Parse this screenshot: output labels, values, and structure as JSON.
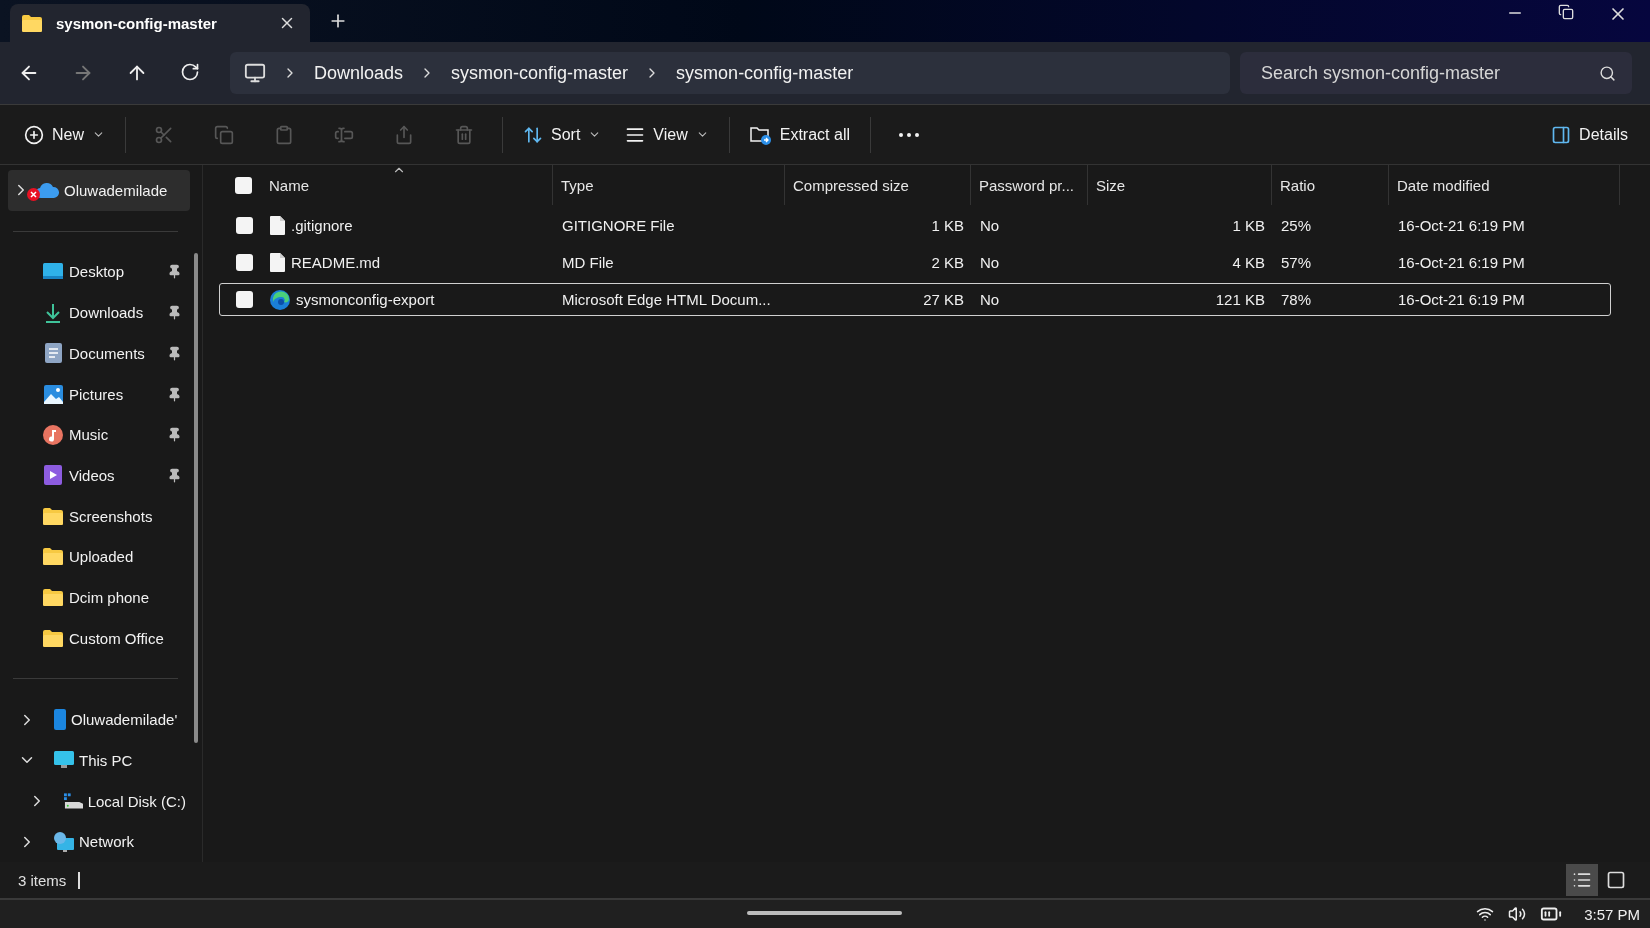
{
  "window": {
    "tabs": [
      {
        "title": "sysmon-config-master",
        "selected": true
      }
    ]
  },
  "navigation": {
    "breadcrumbs": [
      "Downloads",
      "sysmon-config-master",
      "sysmon-config-master"
    ],
    "search": {
      "placeholder": "Search sysmon-config-master"
    }
  },
  "toolbar": {
    "items": [
      {
        "kind": "new",
        "label": "New",
        "disabled": false
      },
      {
        "kind": "cut",
        "disabled": true
      },
      {
        "kind": "copy",
        "disabled": true
      },
      {
        "kind": "paste",
        "disabled": true
      },
      {
        "kind": "rename",
        "disabled": true
      },
      {
        "kind": "share",
        "disabled": true
      },
      {
        "kind": "delete",
        "disabled": true
      },
      {
        "kind": "sort",
        "label": "Sort",
        "disabled": false
      },
      {
        "kind": "view",
        "label": "View",
        "disabled": false
      },
      {
        "kind": "extract",
        "label": "Extract all",
        "disabled": false
      },
      {
        "kind": "more",
        "disabled": false
      }
    ],
    "details": "Details"
  },
  "sidebar": {
    "top": [
      {
        "label": "Oluwademilade",
        "kind": "cloud",
        "selected": true,
        "expanded": false
      }
    ],
    "quick_access": [
      {
        "label": "Desktop",
        "kind": "desktop",
        "pinned": true
      },
      {
        "label": "Downloads",
        "kind": "downloads",
        "pinned": true
      },
      {
        "label": "Documents",
        "kind": "documents",
        "pinned": true
      },
      {
        "label": "Pictures",
        "kind": "pictures",
        "pinned": true
      },
      {
        "label": "Music",
        "kind": "music",
        "pinned": true
      },
      {
        "label": "Videos",
        "kind": "videos",
        "pinned": true
      },
      {
        "label": "Screenshots",
        "kind": "folder",
        "pinned": false
      },
      {
        "label": "Uploaded",
        "kind": "folder",
        "pinned": false
      },
      {
        "label": "Dcim phone",
        "kind": "folder",
        "pinned": false
      },
      {
        "label": "Custom Office",
        "kind": "folder",
        "pinned": false
      }
    ],
    "tree": [
      {
        "label": "Oluwademilade'",
        "kind": "phone",
        "expanded": false
      },
      {
        "label": "This PC",
        "kind": "pc",
        "expanded": true,
        "children": [
          {
            "label": "Local Disk (C:)",
            "kind": "disk",
            "expanded": false
          }
        ]
      },
      {
        "label": "Network",
        "kind": "network",
        "expanded": false
      }
    ]
  },
  "table": {
    "select_all_checked": false,
    "columns": [
      {
        "label": "Name",
        "sorted": true
      },
      {
        "label": "Type",
        "sorted": false
      },
      {
        "label": "Compressed size",
        "sorted": false
      },
      {
        "label": "Password pr...",
        "sorted": false
      },
      {
        "label": "Size",
        "sorted": false
      },
      {
        "label": "Ratio",
        "sorted": false
      },
      {
        "label": "Date modified",
        "sorted": false
      }
    ],
    "rows": [
      {
        "kind": "file",
        "selected": false,
        "checked": false,
        "cells": [
          ".gitignore",
          "GITIGNORE File",
          "1 KB",
          "No",
          "1 KB",
          "25%",
          "16-Oct-21 6:19 PM"
        ]
      },
      {
        "kind": "file",
        "selected": false,
        "checked": false,
        "cells": [
          "README.md",
          "MD File",
          "2 KB",
          "No",
          "4 KB",
          "57%",
          "16-Oct-21 6:19 PM"
        ]
      },
      {
        "kind": "edge",
        "selected": true,
        "checked": false,
        "cells": [
          "sysmonconfig-export",
          "Microsoft Edge HTML Docum...",
          "27 KB",
          "No",
          "121 KB",
          "78%",
          "16-Oct-21 6:19 PM"
        ]
      }
    ]
  },
  "status_bar": {
    "count": "3 items",
    "views": [
      {
        "kind": "details",
        "selected": true
      },
      {
        "kind": "tiles",
        "selected": false
      }
    ]
  },
  "taskbar": {
    "time": "3:57 PM"
  }
}
